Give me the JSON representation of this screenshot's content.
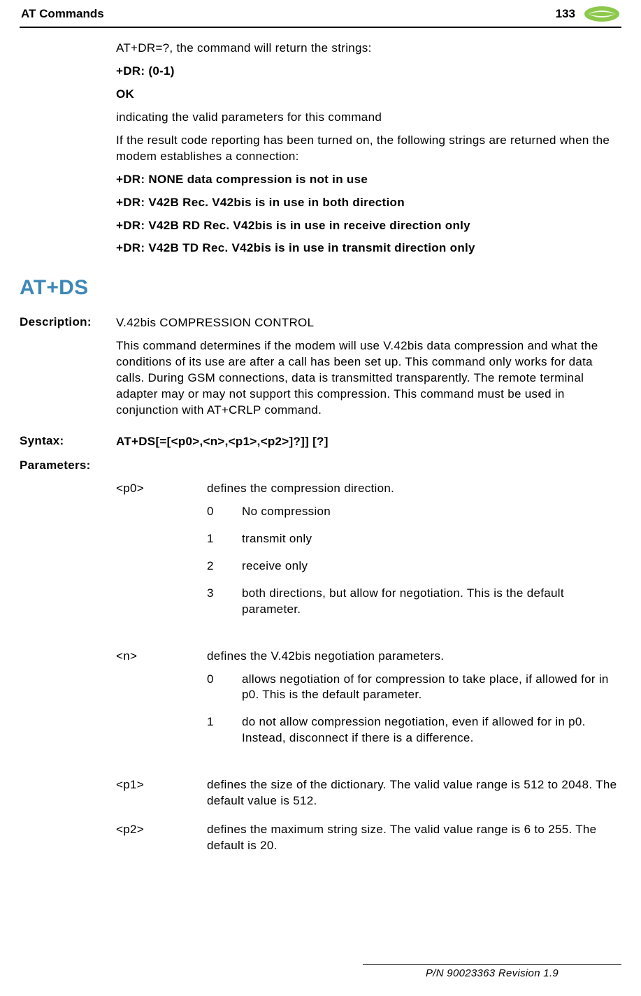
{
  "header": {
    "title": "AT Commands",
    "page": "133"
  },
  "intro": {
    "l1": "AT+DR=?, the command will return the strings:",
    "l2": "+DR: (0-1)",
    "l3": "OK",
    "l4": "indicating the valid parameters for this command",
    "l5": "If the result code reporting has been turned on, the following strings are returned when the modem establishes a connection:",
    "l6": "+DR: NONE data compression is not in use",
    "l7": "+DR: V42B Rec. V42bis is in use in both direction",
    "l8": "+DR: V42B RD Rec. V42bis is in use in receive direction only",
    "l9": "+DR: V42B TD Rec. V42bis is in use in transmit direction only"
  },
  "section": {
    "title": "AT+DS"
  },
  "desc": {
    "label": "Description:",
    "line1": "V.42bis COMPRESSION CONTROL",
    "line2": "This command determines if the modem will use V.42bis data compression and what the conditions of its use are after a call has been set up. This command only works for data calls. During GSM connections, data is transmitted transparently. The remote terminal adapter may or may not support this compression. This command must be used in conjunction with AT+CRLP command."
  },
  "syntax": {
    "label": "Syntax:",
    "value": "AT+DS[=[<p0>,<n>,<p1>,<p2>]?]] [?]"
  },
  "params": {
    "label": "Parameters:",
    "p0": {
      "name": "<p0>",
      "desc": "defines the compression direction.",
      "opts": {
        "0": {
          "k": "0",
          "v": "No compression"
        },
        "1": {
          "k": "1",
          "v": "transmit only"
        },
        "2": {
          "k": "2",
          "v": "receive only"
        },
        "3": {
          "k": "3",
          "v": "both directions, but allow for negotiation. This is the default parameter."
        }
      }
    },
    "n": {
      "name": "<n>",
      "desc": "defines the V.42bis negotiation parameters.",
      "opts": {
        "0": {
          "k": "0",
          "v": "allows negotiation of for compression to take place, if allowed for in p0. This is the default parameter."
        },
        "1": {
          "k": "1",
          "v": "do not allow compression negotiation, even if allowed for in p0. Instead, disconnect if there is a difference."
        }
      }
    },
    "p1": {
      "name": "<p1>",
      "desc": "defines the size of the dictionary. The valid value range is 512 to 2048. The default value is 512."
    },
    "p2": {
      "name": "<p2>",
      "desc": "defines the maximum string size. The valid value range is 6 to 255. The default is 20."
    }
  },
  "footer": {
    "text": "P/N 90023363  Revision 1.9"
  }
}
